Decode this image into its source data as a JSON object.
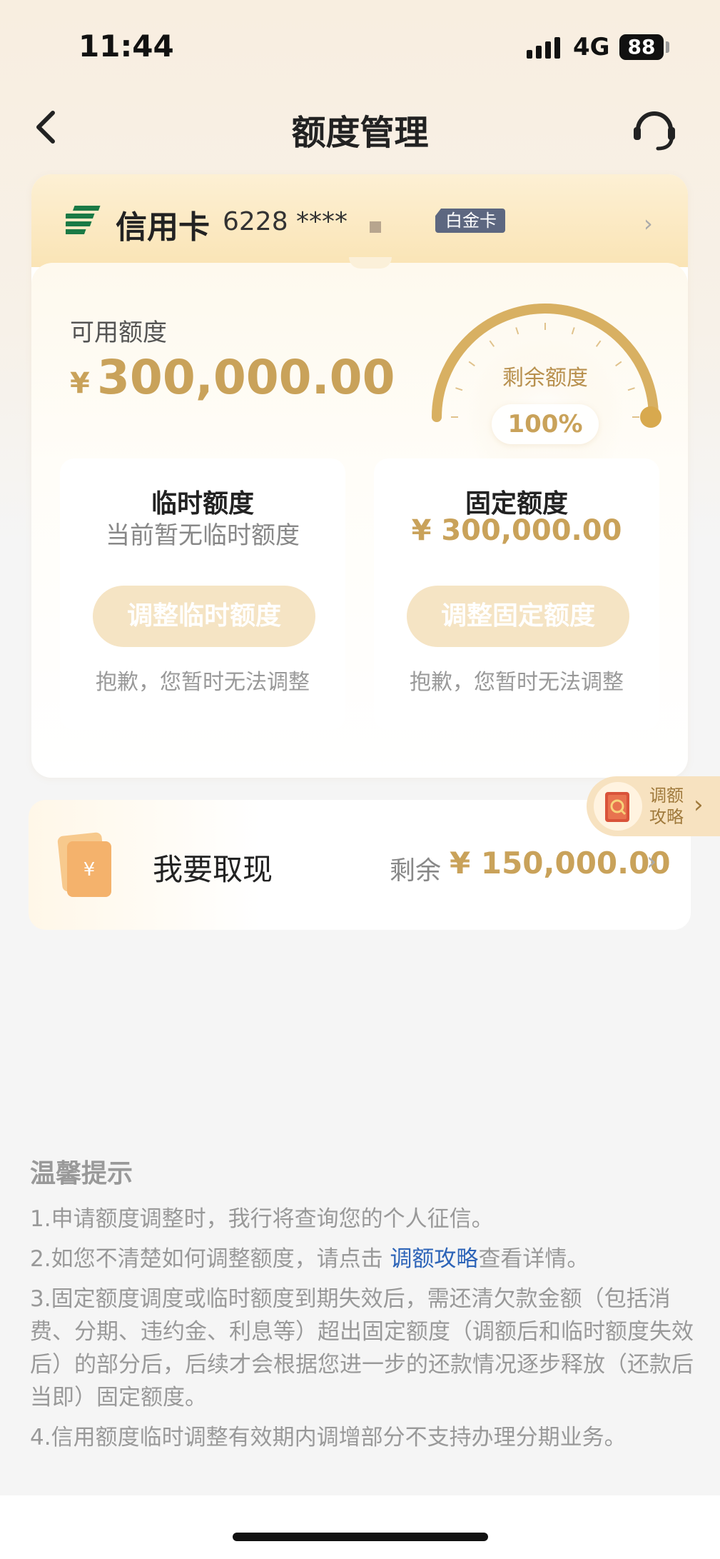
{
  "status_bar": {
    "time": "11:44",
    "network": "4G",
    "battery": "88"
  },
  "nav": {
    "title": "额度管理"
  },
  "card": {
    "type": "信用卡",
    "number": "6228 ****",
    "tier": "白金卡",
    "available_label": "可用额度",
    "currency": "¥",
    "available_amount": "300,000.00",
    "gauge_label": "剩余额度",
    "gauge_percent": "100%",
    "gauge_fraction": 1.0
  },
  "temp_limit": {
    "title": "临时额度",
    "status": "当前暂无临时额度",
    "button": "调整临时额度",
    "note": "抱歉，您暂时无法调整"
  },
  "fixed_limit": {
    "title": "固定额度",
    "amount": "¥ 300,000.00",
    "button": "调整固定额度",
    "note": "抱歉，您暂时无法调整"
  },
  "strategy_tab": {
    "line1": "调额",
    "line2": "攻略"
  },
  "cash": {
    "label": "我要取现",
    "remain_label": "剩余",
    "amount": "¥ 150,000.00"
  },
  "tips": {
    "title": "温馨提示",
    "item1": "1.申请额度调整时，我行将查询您的个人征信。",
    "item2_pre": "2.如您不清楚如何调整额度，请点击 ",
    "item2_link": "调额攻略",
    "item2_post": "查看详情。",
    "item3": "3.固定额度调度或临时额度到期失效后，需还清欠款金额（包括消费、分期、违约金、利息等）超出固定额度（调额后和临时额度失效后）的部分后，后续才会根据您进一步的还款情况逐步释放（还款后当即）固定额度。",
    "item4": "4.信用额度临时调整有效期内调增部分不支持办理分期业务。"
  },
  "colors": {
    "gold": "#c9a25a",
    "link": "#2d64b8",
    "badge": "#5d6780",
    "logo_green": "#1a7a45"
  }
}
